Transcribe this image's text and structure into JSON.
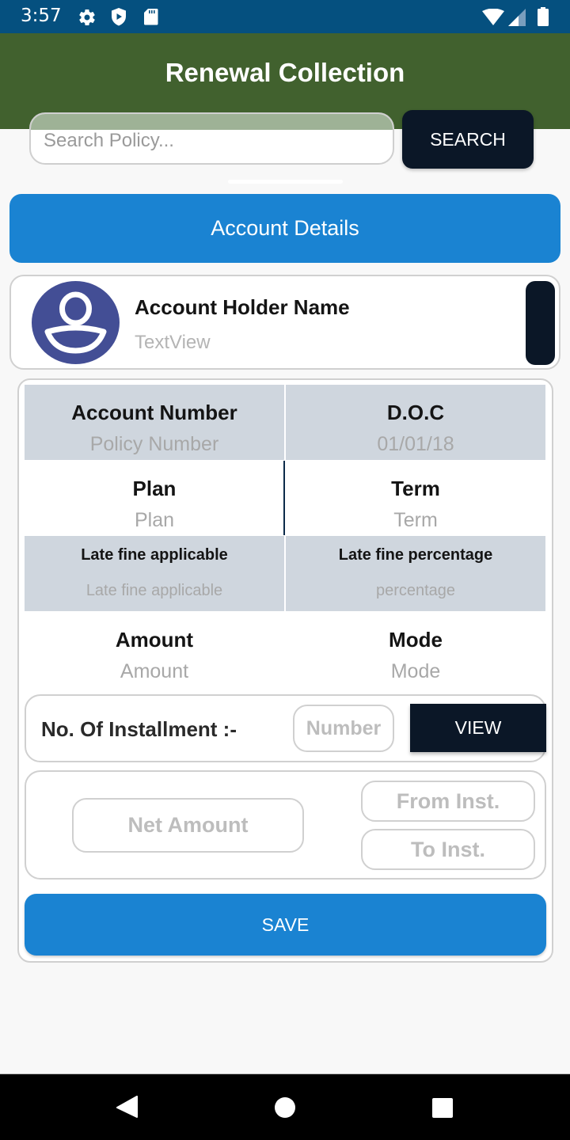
{
  "status_bar": {
    "time": "3:57",
    "left_icons": [
      "settings-icon",
      "play-protect-icon",
      "sd-card-icon"
    ],
    "right_icons": [
      "wifi-icon",
      "cell-signal-icon",
      "battery-icon"
    ]
  },
  "app_bar": {
    "title": "Renewal Collection"
  },
  "search": {
    "placeholder": "Search Policy...",
    "value": "",
    "button_label": "SEARCH"
  },
  "section_header": "Account Details",
  "holder": {
    "avatar_icon": "account-circle-icon",
    "name_label": "Account Holder Name",
    "name_value": "TextView"
  },
  "details": [
    {
      "label": "Account Number",
      "value": "Policy Number"
    },
    {
      "label": "D.O.C",
      "value": "01/01/18"
    },
    {
      "label": "Plan",
      "value": "Plan"
    },
    {
      "label": "Term",
      "value": "Term"
    },
    {
      "label": "Late fine applicable",
      "value": "Late fine applicable"
    },
    {
      "label": "Late fine percentage",
      "value": "percentage"
    },
    {
      "label": "Amount",
      "value": "Amount"
    },
    {
      "label": "Mode",
      "value": "Mode"
    }
  ],
  "installment": {
    "label": "No. Of Installment :-",
    "number_placeholder": "Number",
    "view_label": "VIEW"
  },
  "amount_fields": {
    "net_amount_placeholder": "Net Amount",
    "from_inst_placeholder": "From Inst.",
    "to_inst_placeholder": "To Inst."
  },
  "save_label": "SAVE",
  "nav_bar": {
    "back": "back-icon",
    "home": "home-icon",
    "recents": "recents-icon"
  }
}
